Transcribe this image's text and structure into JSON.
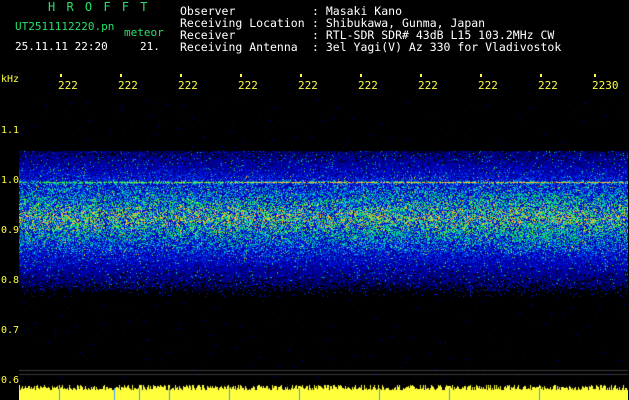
{
  "header": {
    "logo": "H R O F F T",
    "filename": "UT2511112220.pn",
    "tag": "meteor",
    "datetime": "25.11.11 22:20",
    "count": "21.",
    "rows": [
      {
        "label": "Observer",
        "value": ": Masaki Kano"
      },
      {
        "label": "Receiving Location",
        "value": ": Shibukawa, Gunma, Japan"
      },
      {
        "label": "Receiver",
        "value": ": RTL-SDR SDR# 43dB L15 103.2MHz CW"
      },
      {
        "label": "Receiving Antenna",
        "value": ": 3el Yagi(V) Az 330 for Vladivostok"
      }
    ]
  },
  "axis": {
    "unit": "kHz",
    "time_ticks": [
      "222",
      "222",
      "222",
      "222",
      "222",
      "222",
      "222",
      "222",
      "222",
      "2230"
    ],
    "freq_ticks": [
      "1.1",
      "1.0",
      "0.9",
      "0.8",
      "0.7",
      "0.6"
    ]
  },
  "colors": {
    "header_green": "#27e06a",
    "tick_yellow": "#ffff3c",
    "background": "#000000"
  }
}
